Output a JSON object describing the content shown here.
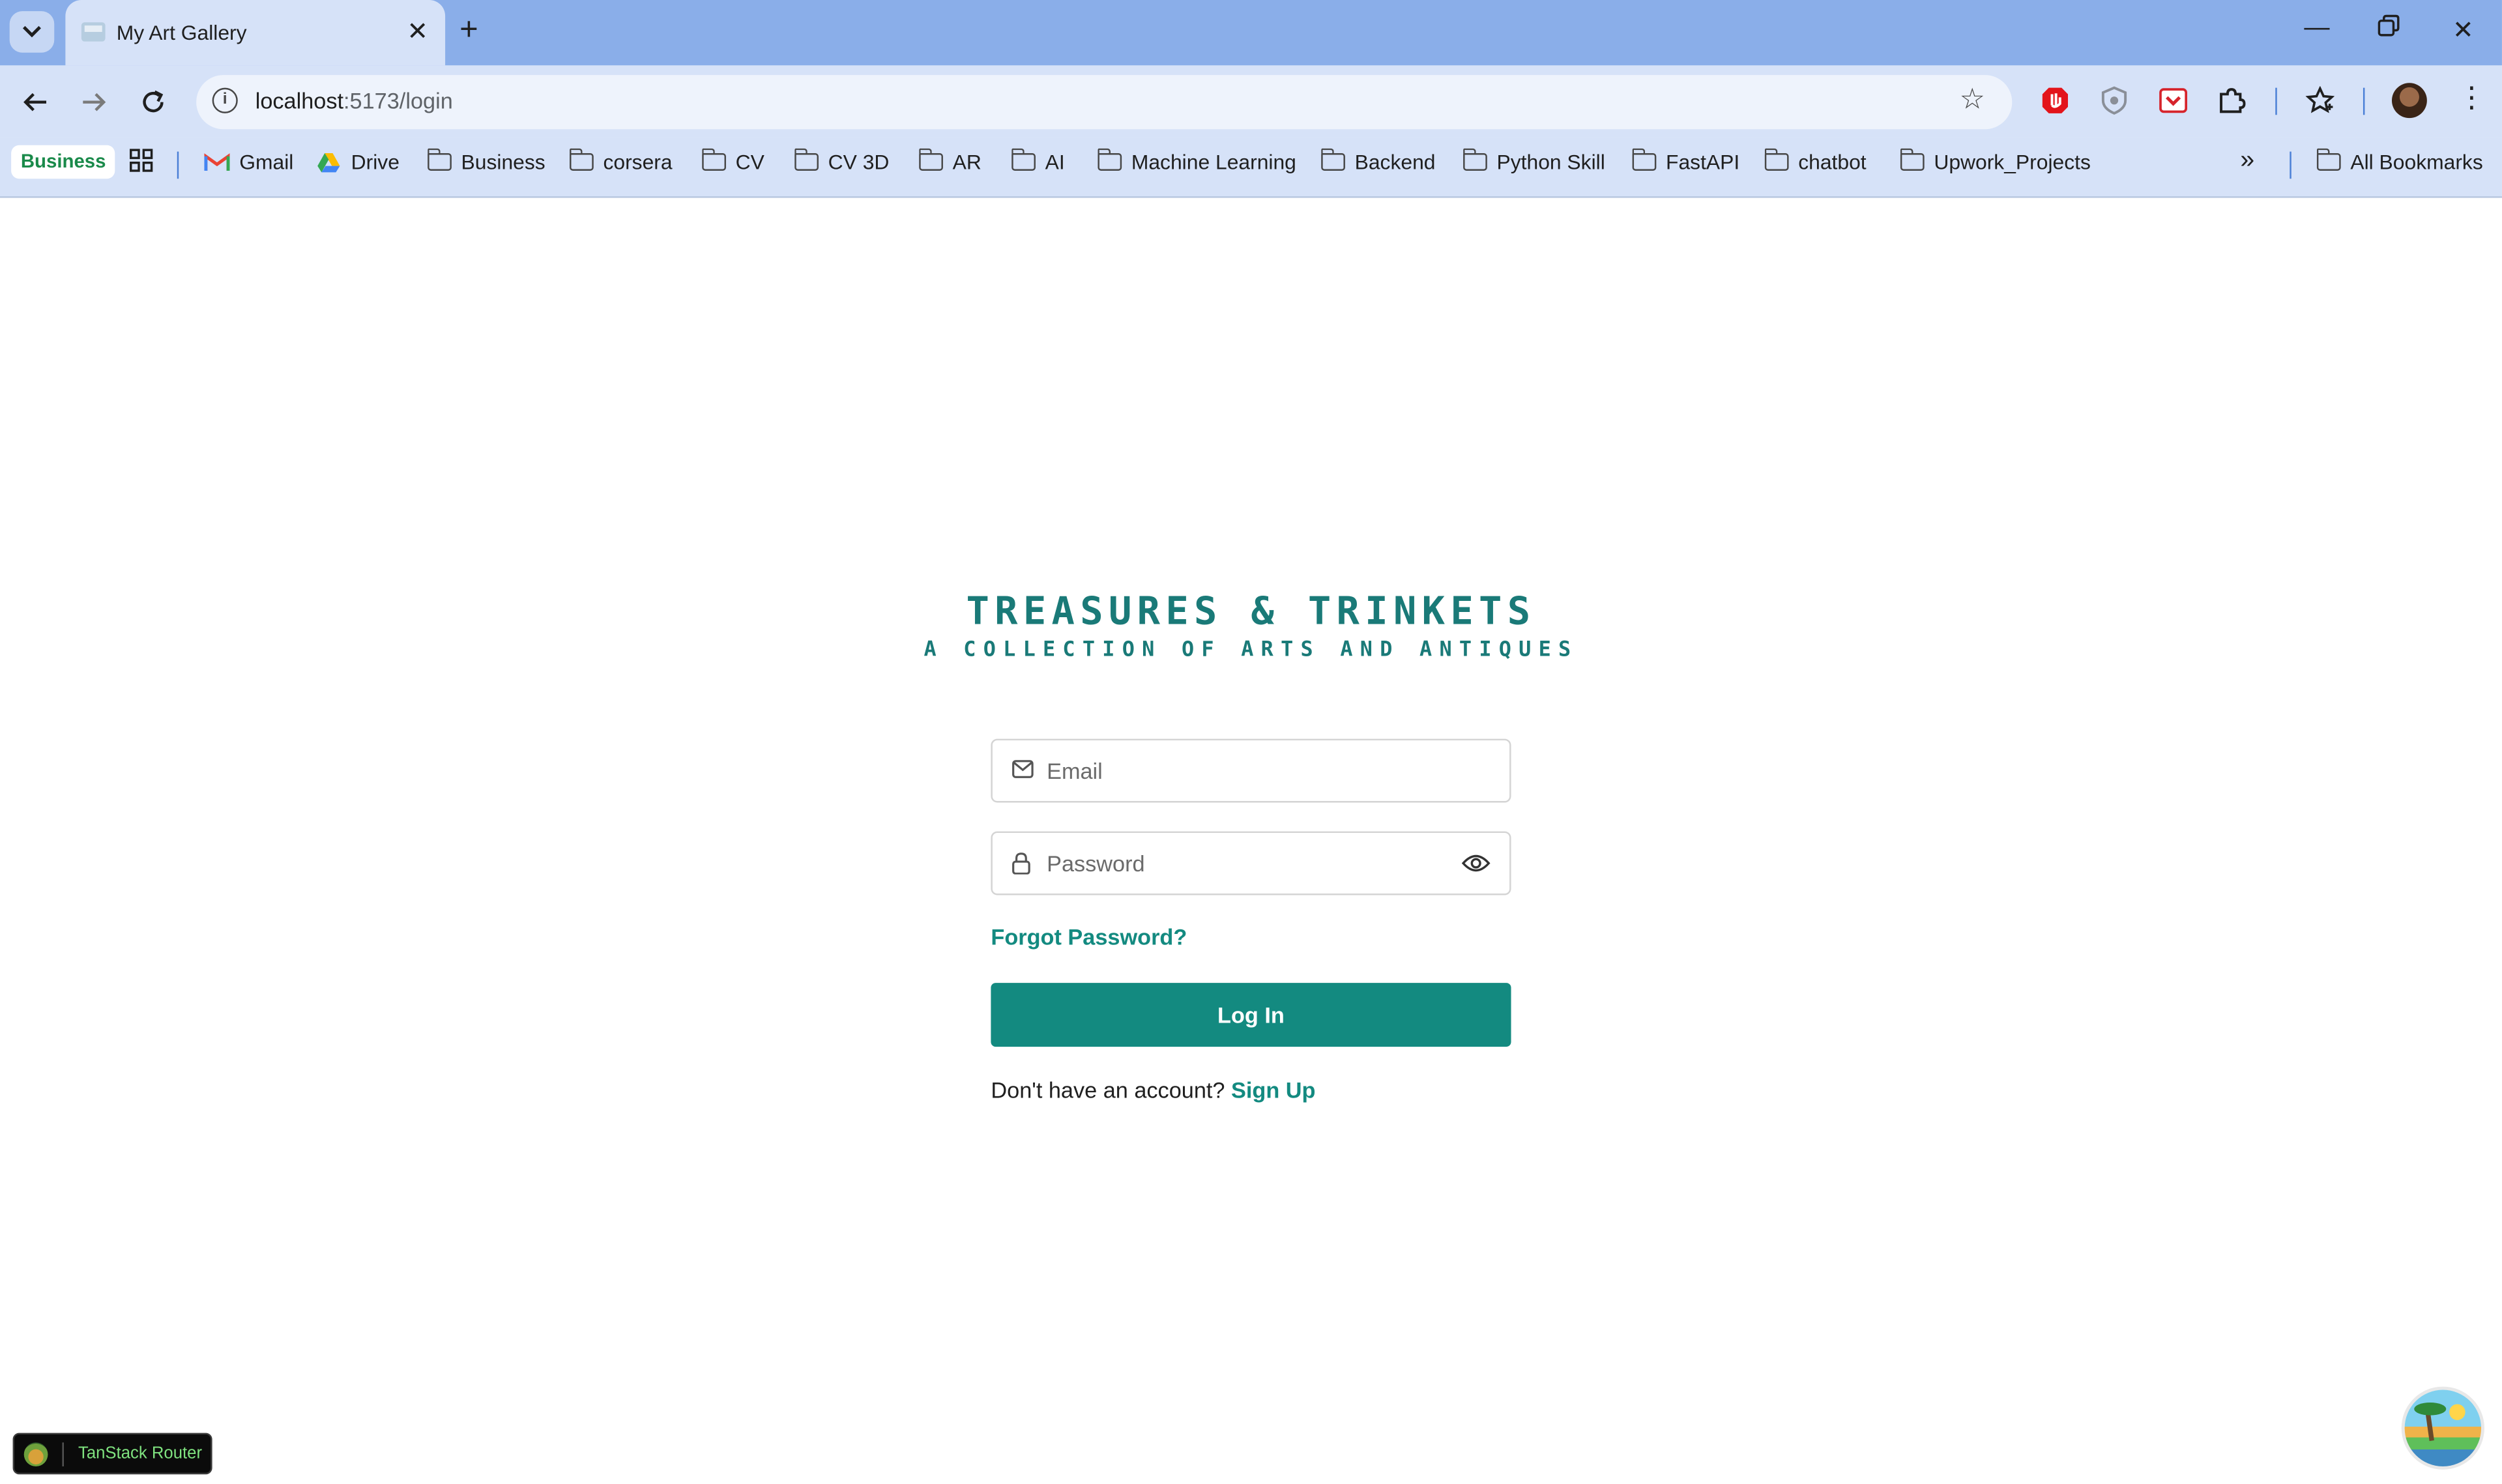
{
  "browser": {
    "tab_title": "My Art Gallery",
    "url_host": "localhost",
    "url_path": ":5173/login",
    "bookmarks_badge": "Business",
    "bookmarks": [
      "Gmail",
      "Drive",
      "Business",
      "corsera",
      "CV",
      "CV 3D",
      "AR",
      "AI",
      "Machine Learning",
      "Backend",
      "Python Skill",
      "FastAPI",
      "chatbot",
      "Upwork_Projects"
    ],
    "all_bookmarks": "All Bookmarks"
  },
  "brand": {
    "title": "TREASURES & TRINKETS",
    "subtitle": "A COLLECTION OF ARTS AND ANTIQUES",
    "color": "#1a7a78"
  },
  "login_form": {
    "email_placeholder": "Email",
    "password_placeholder": "Password",
    "forgot_password": "Forgot Password?",
    "login_button": "Log In",
    "no_account_text": "Don't have an account?",
    "sign_up_link": "Sign Up",
    "accent_color": "#138a80"
  },
  "devtools": {
    "tanstack_label": "TanStack Router"
  }
}
